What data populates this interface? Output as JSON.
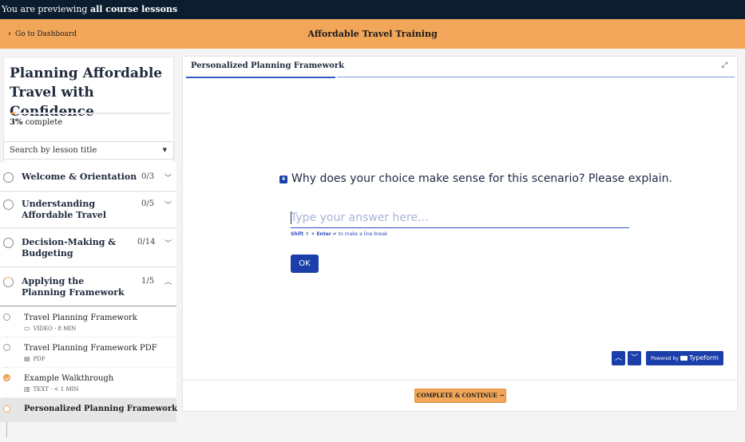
{
  "preview": {
    "prefix": "You are previewing ",
    "emphasis": "all course lessons"
  },
  "topbar": {
    "back_label": "Go to Dashboard",
    "course_title": "Affordable Travel Training"
  },
  "sidebar": {
    "course_heading": "Planning Affordable Travel with Confidence",
    "progress": {
      "percent": 3,
      "percent_text": "3%",
      "label": " complete"
    },
    "search": {
      "placeholder": "Search by lesson title"
    },
    "modules": [
      {
        "name": "Welcome & Orientation",
        "count": "0/3"
      },
      {
        "name": "Understanding Affordable Travel",
        "count": "0/5"
      },
      {
        "name": "Decision-Making & Budgeting",
        "count": "0/14"
      },
      {
        "name": "Applying the Planning Framework",
        "count": "1/5"
      }
    ],
    "lessons": [
      {
        "title": "Travel Planning Framework",
        "meta_icon": "video-icon",
        "meta": "VIDEO · 8 MIN"
      },
      {
        "title": "Travel Planning Framework PDF",
        "meta_icon": "pdf-icon",
        "meta": "PDF"
      },
      {
        "title": "Example Walkthrough",
        "meta_icon": "text-icon",
        "meta": "TEXT · < 1 MIN"
      },
      {
        "title": "Personalized Planning Framework"
      }
    ]
  },
  "main": {
    "title": "Personalized Planning Framework",
    "question_number": "4",
    "question": "Why does your choice make sense for this scenario? Please explain.",
    "answer_value": "",
    "answer_placeholder": "Type your answer here...",
    "hint_keys": "Shift ⇧ + Enter ↵",
    "hint_text": " to make a line break",
    "ok_label": "OK",
    "powered_prefix": "Powered by",
    "powered_brand": "Typeform",
    "complete_label": "COMPLETE & CONTINUE →"
  },
  "colors": {
    "accent": "#f2a65a",
    "typeform_blue": "#1b3faa",
    "preview_bar": "#0b1d2e"
  }
}
